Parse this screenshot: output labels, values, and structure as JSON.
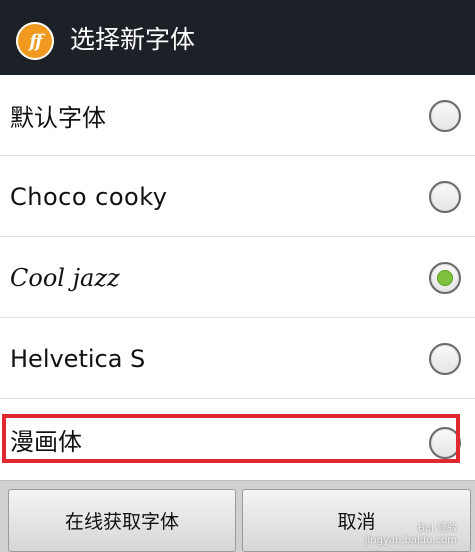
{
  "title": "选择新字体",
  "logo_text": "ff",
  "fonts": [
    {
      "label": "默认字体",
      "selected": false
    },
    {
      "label": "Choco cooky",
      "selected": false
    },
    {
      "label": "Cool jazz",
      "selected": true
    },
    {
      "label": "Helvetica S",
      "selected": false
    },
    {
      "label": "漫画体",
      "selected": false
    }
  ],
  "buttons": {
    "online": "在线获取字体",
    "cancel": "取消"
  },
  "watermark": {
    "text": "Bai 经验",
    "url": "jingyan.baidu.com"
  },
  "colors": {
    "titlebar": "#1c2027",
    "logo": "#f29a1f",
    "radio_selected": "#7fc23f",
    "highlight": "#e0282e"
  }
}
